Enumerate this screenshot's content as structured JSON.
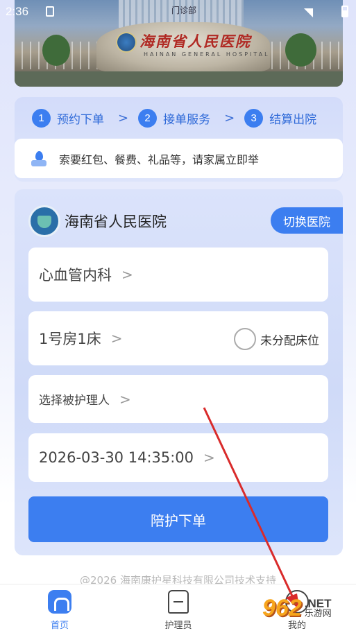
{
  "status_bar": {
    "time": "2:36"
  },
  "banner": {
    "gate_text": "门诊部",
    "hospital_title": "海南省人民医院",
    "hospital_sub": "HAINAN GENERAL HOSPITAL"
  },
  "steps": [
    {
      "num": "1",
      "label": "预约下单"
    },
    {
      "num": "2",
      "label": "接单服务"
    },
    {
      "num": "3",
      "label": "结算出院"
    }
  ],
  "notice": {
    "text": "索要红包、餐费、礼品等，请家属立即举"
  },
  "hospital": {
    "name": "海南省人民医院",
    "switch_label": "切换医院"
  },
  "form": {
    "department": "心血管内科",
    "bed": "1号房1床",
    "unassigned_label": "未分配床位",
    "patient_placeholder": "选择被护理人",
    "datetime": "2026-03-30 14:35:00",
    "submit_label": "陪护下单"
  },
  "footer": {
    "copyright": "@2026 海南康护星科技有限公司技术支持"
  },
  "tabbar": [
    {
      "label": "首页",
      "icon": "home-icon",
      "active": true
    },
    {
      "label": "护理员",
      "icon": "nurse-icon",
      "active": false
    },
    {
      "label": "我的",
      "icon": "user-icon",
      "active": false
    }
  ],
  "watermark": {
    "num": "962",
    "net": ".NET",
    "cn": "乐游网"
  },
  "colors": {
    "accent": "#3c7ef0",
    "annotation_arrow": "#d92b2b"
  }
}
